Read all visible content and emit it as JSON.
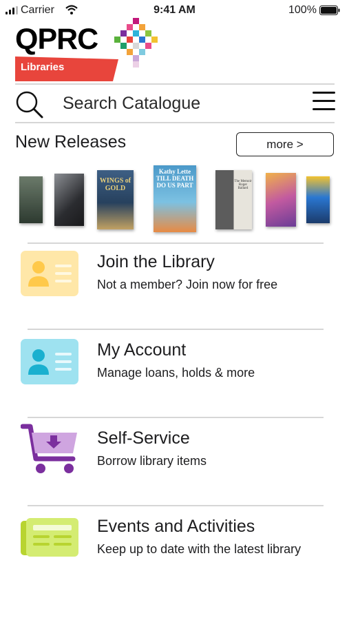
{
  "status_bar": {
    "carrier": "Carrier",
    "time": "9:41 AM",
    "battery": "100%"
  },
  "header": {
    "logo": "QPRC",
    "logo_sub": "Libraries"
  },
  "search": {
    "placeholder": "Search Catalogue"
  },
  "new_releases": {
    "title": "New Releases",
    "more_label": "more >"
  },
  "books": [
    {
      "cover_text": "",
      "colors": [
        "#6b7a6a",
        "#2d3a30"
      ]
    },
    {
      "cover_text": "",
      "colors": [
        "#7c7f84",
        "#2b2c30"
      ]
    },
    {
      "cover_text": "WINGS of GOLD",
      "colors": [
        "#3e5f84",
        "#c1a162"
      ]
    },
    {
      "cover_text": "Kathy Lette TILL DEATH DO US PART",
      "colors": [
        "#4b99c9",
        "#e88b44"
      ]
    },
    {
      "cover_text": "The Memoir Roger Ballard",
      "colors": [
        "#5c5c5c",
        "#e7e4dc"
      ]
    },
    {
      "cover_text": "",
      "colors": [
        "#c25aa0",
        "#f0b14a"
      ]
    },
    {
      "cover_text": "",
      "colors": [
        "#2a77d1",
        "#f2c230"
      ]
    }
  ],
  "menu": [
    {
      "title": "Join the Library",
      "subtitle": "Not a member? Join now for free",
      "icon": "id-card-icon",
      "color": "#ffe7a8"
    },
    {
      "title": "My Account",
      "subtitle": "Manage loans, holds & more",
      "icon": "account-card-icon",
      "color": "#9ee2f0"
    },
    {
      "title": "Self-Service",
      "subtitle": "Borrow library items",
      "icon": "shopping-cart-icon",
      "color": "#7b2f9e"
    },
    {
      "title": "Events and Activities",
      "subtitle": "Keep up to date with the latest library",
      "icon": "newspaper-icon",
      "color": "#d4ec72"
    }
  ],
  "colors": {
    "brand_red": "#e8453c",
    "text": "#1d1d1f",
    "divider": "#d6d6d6"
  }
}
